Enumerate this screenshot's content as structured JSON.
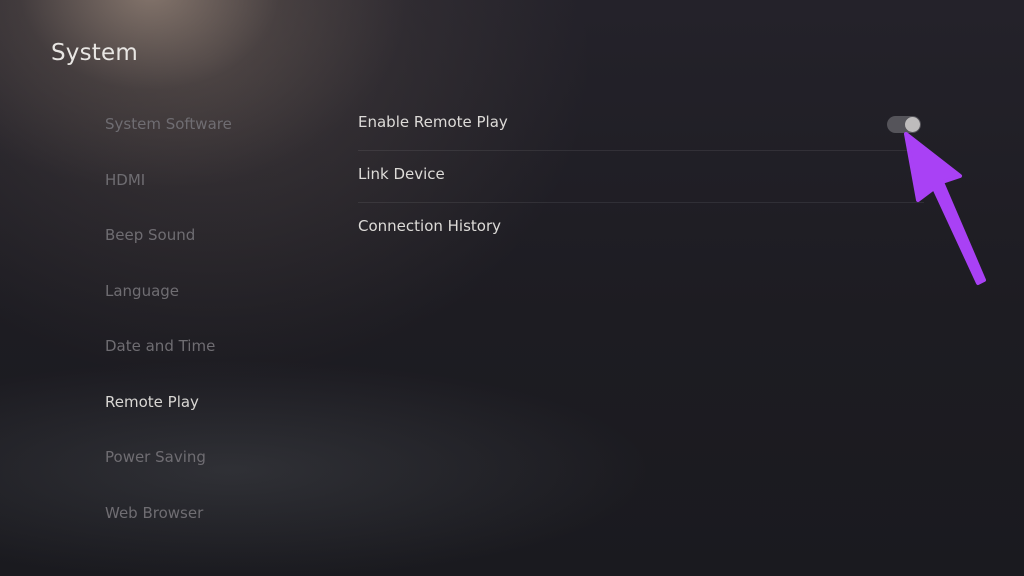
{
  "header": {
    "title": "System"
  },
  "sidebar": {
    "items": [
      {
        "label": "System Software",
        "active": false
      },
      {
        "label": "HDMI",
        "active": false
      },
      {
        "label": "Beep Sound",
        "active": false
      },
      {
        "label": "Language",
        "active": false
      },
      {
        "label": "Date and Time",
        "active": false
      },
      {
        "label": "Remote Play",
        "active": true
      },
      {
        "label": "Power Saving",
        "active": false
      },
      {
        "label": "Web Browser",
        "active": false
      }
    ]
  },
  "main": {
    "options": [
      {
        "label": "Enable Remote Play",
        "control": "toggle",
        "enabled": true
      },
      {
        "label": "Link Device"
      },
      {
        "label": "Connection History"
      }
    ]
  },
  "annotation": {
    "icon": "arrow-pointer-icon",
    "color": "#a941f5"
  },
  "colors": {
    "background": "#1c1b21",
    "text_active": "#d9d7d4",
    "text_inactive": "#6f6d72"
  }
}
